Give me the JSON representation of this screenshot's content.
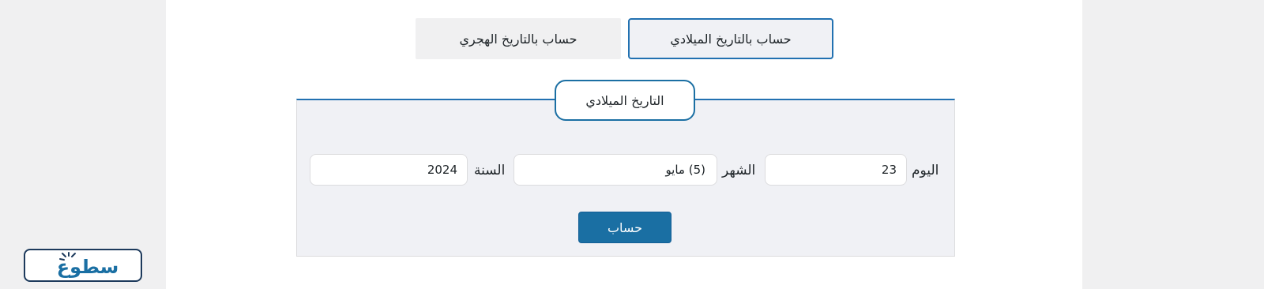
{
  "tabs": {
    "gregorian": "حساب بالتاريخ الميلادي",
    "hijri": "حساب بالتاريخ الهجري"
  },
  "form": {
    "legend": "التاريخ الميلادي",
    "day_label": "اليوم",
    "day_value": "23",
    "month_label": "الشهر",
    "month_value": "(5) مايو",
    "year_label": "السنة",
    "year_value": "2024",
    "submit_label": "حساب"
  },
  "logo": {
    "text": "سطوع"
  },
  "colors": {
    "accent": "#2271b1",
    "button": "#1a6fa3",
    "panel": "#f0f1f5"
  }
}
